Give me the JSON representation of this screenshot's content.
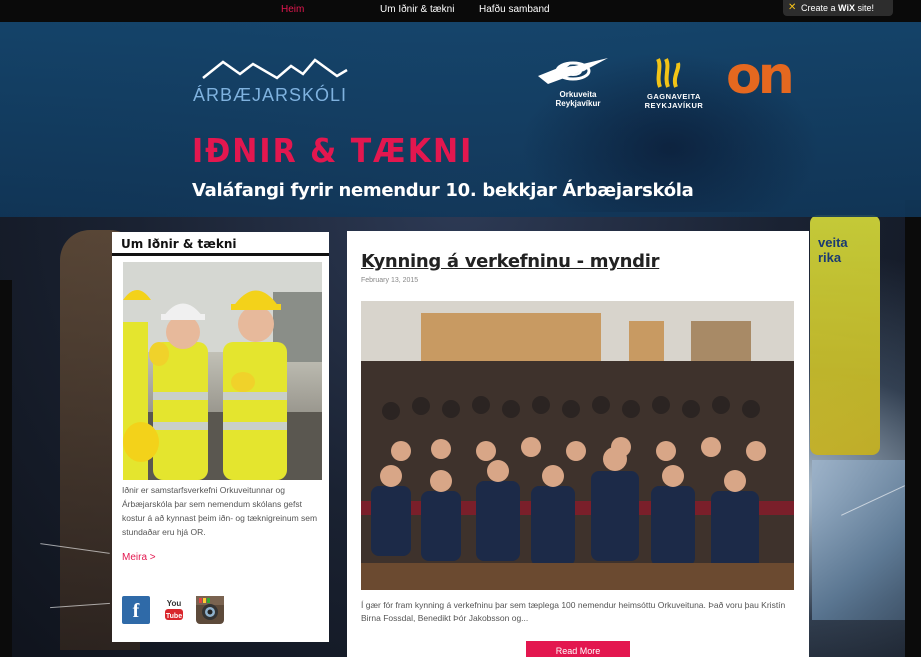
{
  "nav": {
    "items": [
      {
        "label": "Heim",
        "active": true
      },
      {
        "label": "Um Iðnir & tækni",
        "active": false
      },
      {
        "label": "Hafðu samband",
        "active": false
      }
    ]
  },
  "wix_badge": {
    "prefix": "Create a ",
    "brand": "WiX",
    "suffix": " site!"
  },
  "header": {
    "school_name": "ÁRBÆJARSKÓLI",
    "partner_or": "Orkuveita\nReykjavíkur",
    "partner_gr": "GAGNAVEITA\nREYKJAVÍKUR",
    "partner_on": "on",
    "title": "IÐNIR & TÆKNI",
    "subtitle": "Valáfangi fyrir nemendur 10. bekkjar Árbæjarskóla"
  },
  "sidebar": {
    "title": "Um Iðnir & tækni",
    "text": "Iðnir er samstarfsverkefni Orkuveitunnar og Árbæjarskóla þar sem nemendum skólans gefst kostur á að kynnast þeim iðn- og tæknigreinum sem stundaðar eru hjá OR.",
    "more_label": "Meira >",
    "social": [
      {
        "icon": "facebook-icon",
        "label": "f"
      },
      {
        "icon": "youtube-icon",
        "label": "You Tube"
      },
      {
        "icon": "instagram-icon",
        "label": ""
      }
    ]
  },
  "post": {
    "title": "Kynning á verkefninu - myndir",
    "date": "February 13, 2015",
    "excerpt": "Í gær fór fram kynning á verkefninu þar sem tæplega 100 nemendur heimsóttu Orkuveituna. Það voru þau Kristín Birna Fossdal, Benedikt Þór Jakobsson og...",
    "read_more_label": "Read More"
  },
  "background": {
    "vest_text": "veita\nrika"
  },
  "colors": {
    "accent": "#e3174f",
    "header_blue": "#14466e",
    "on_orange": "#e5681f",
    "school_blue": "#7fb2df"
  }
}
